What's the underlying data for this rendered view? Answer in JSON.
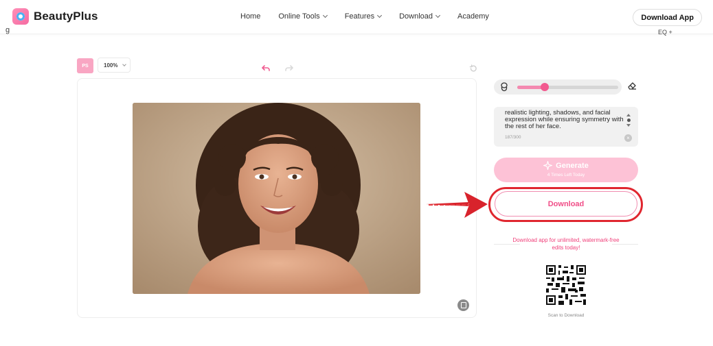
{
  "header": {
    "brand": "BeautyPlus",
    "nav": [
      {
        "label": "Home",
        "has_dropdown": false
      },
      {
        "label": "Online Tools",
        "has_dropdown": true
      },
      {
        "label": "Features",
        "has_dropdown": true
      },
      {
        "label": "Download",
        "has_dropdown": true
      },
      {
        "label": "Academy",
        "has_dropdown": false
      }
    ],
    "cta": "Download App",
    "left_fragment": "g",
    "right_fragment": "EQ  +"
  },
  "toolbar": {
    "badge": "PS",
    "zoom": "100%",
    "icons": [
      "undo-icon",
      "redo-icon",
      "reset-icon"
    ]
  },
  "editor": {
    "brush": {
      "size_fraction": 0.27
    },
    "prompt": {
      "text": "realistic lighting, shadows, and facial expression while ensuring symmetry with the rest of her face.",
      "count": "187/300"
    },
    "generate": {
      "label": "Generate",
      "sub": "4 Times Left Today"
    },
    "download_label": "Download",
    "promo": "Download app for unlimited, watermark-free edits today!",
    "scan_label": "Scan to Download"
  },
  "colors": {
    "accent": "#f04c86",
    "generate_bg": "#fdc2d6",
    "highlight_red": "#e0262f"
  }
}
